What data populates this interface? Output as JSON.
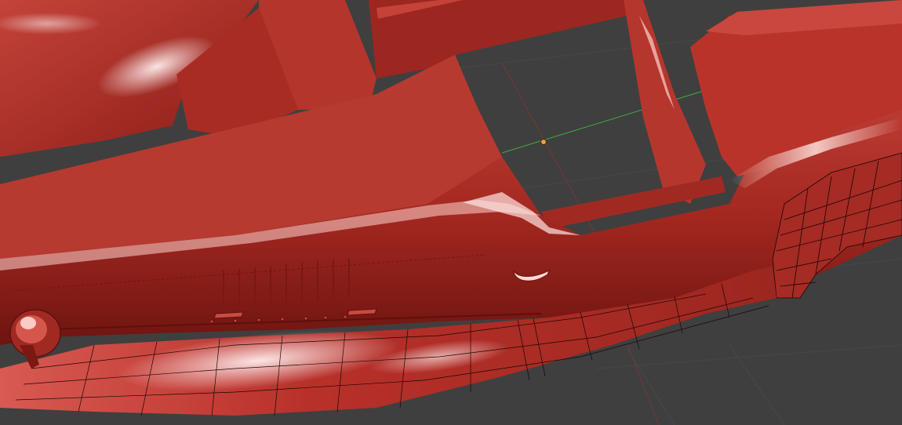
{
  "viewport": {
    "background_color": "#3f3f3f",
    "grid_color": "#4a4a4a",
    "x_axis_color": "#3fae3f",
    "y_axis_color": "#8a3a3a",
    "origin_color": "#e8a040",
    "model_color": "#b8302a",
    "model_shadow_color": "#6e1410",
    "model_highlight_color": "#ffe8e4",
    "wireframe_color": "#1a0505"
  }
}
